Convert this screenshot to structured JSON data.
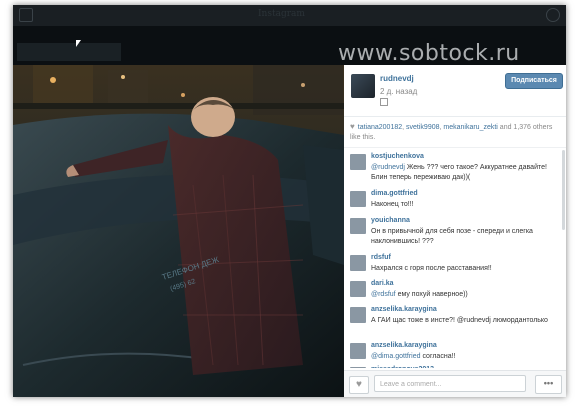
{
  "watermark": "www.sobtock.ru",
  "header": {
    "username": "rudnevdj",
    "time_ago": "2 д. назад",
    "follow_label": "Подписаться"
  },
  "likes": {
    "users": [
      "tatiana200182",
      "svetik9908",
      "mekanikaru_zekti"
    ],
    "count_text": " and 1,376 others like this."
  },
  "comments": [
    {
      "user": "kostjuchenkova",
      "mention": "@rudnevdj",
      "text": " Жень ??? чего такое? Аккуратнее давайте! Блин теперь переживаю дак))("
    },
    {
      "user": "dima.gottfried",
      "mention": "",
      "text": "Наконец то!!!"
    },
    {
      "user": "youichanna",
      "mention": "",
      "text": "Он в привычной для себя позе - спереди и слегка наклонившись! ???"
    },
    {
      "user": "rdsfuf",
      "mention": "",
      "text": "Нахрался с горя после расставания!!"
    },
    {
      "user": "dari.ka",
      "mention": "@rdsfuf",
      "text": " ему похуй наверное))"
    },
    {
      "user": "anzselika.karaygina",
      "mention": "",
      "text": "А ГАИ щас тоже в инсте?! @rudnevdj люмордантолько"
    },
    {
      "user": "anzselika.karaygina",
      "mention": "@dima.gottfried",
      "text": " согласна!!"
    },
    {
      "user": "missadronova2013",
      "mention": "",
      "text": ""
    }
  ],
  "footer": {
    "comment_placeholder": "Leave a comment...",
    "more_label": "•••"
  },
  "photo": {
    "car_text_1": "ТЕЛЕФОН ДЕЖ",
    "car_text_2": "(495) 62"
  }
}
